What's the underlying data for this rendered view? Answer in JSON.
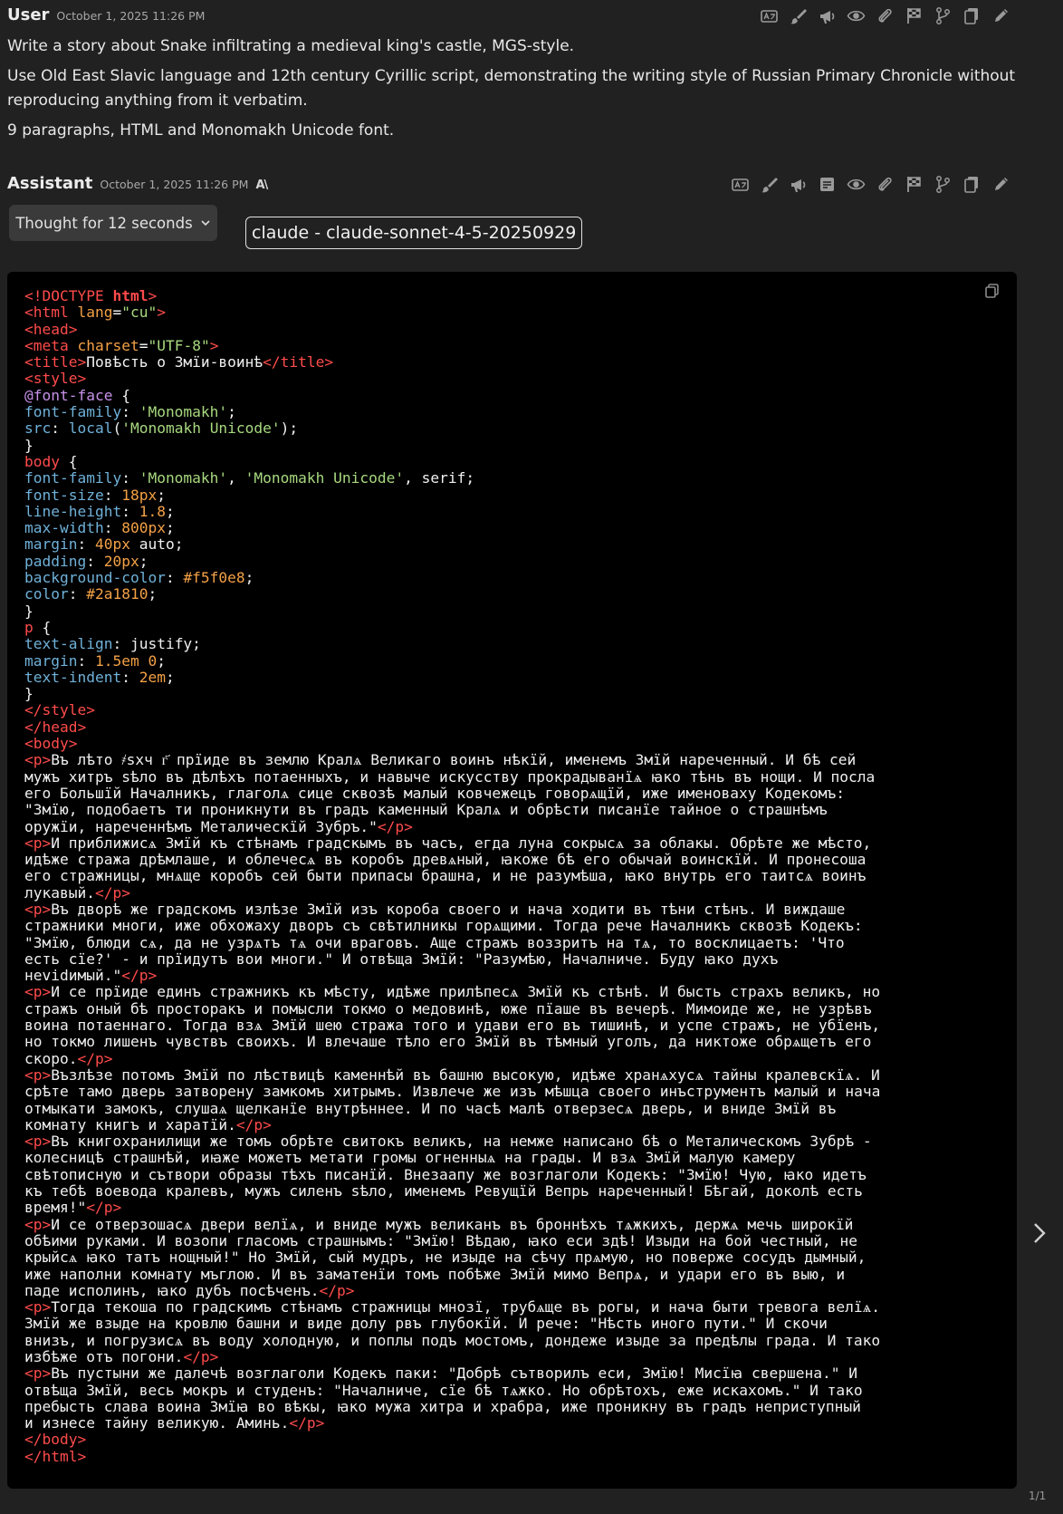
{
  "user_msg": {
    "author": "User",
    "timestamp": "October 1, 2025 11:26 PM",
    "paragraphs": [
      "Write a story about Snake infiltrating a medieval king's castle, MGS-style.",
      "Use Old East Slavic language and 12th century Cyrillic script, demonstrating the writing style of Russian Primary Chronicle without reproducing anything from it verbatim.",
      "9 paragraphs, HTML and Monomakh Unicode font."
    ]
  },
  "assistant_msg": {
    "author": "Assistant",
    "timestamp": "October 1, 2025 11:26 PM",
    "model_mark": "A\\",
    "thought_label": "Thought for 12 seconds",
    "model_tag": "claude - claude-sonnet-4-5-20250929"
  },
  "toolbar_icons": [
    "translate-icon",
    "brush-icon",
    "megaphone-icon",
    "note-icon",
    "eye-icon",
    "paperclip-icon",
    "flag-icon",
    "branch-icon",
    "copy-icon",
    "edit-icon"
  ],
  "code": {
    "language": "html",
    "lines": [
      [
        [
          "t",
          "<!DOCTYPE "
        ],
        [
          "tb",
          "html"
        ],
        [
          "t",
          ">"
        ]
      ],
      [
        [
          "t",
          "<html "
        ],
        [
          "a",
          "lang"
        ],
        [
          "br",
          "="
        ],
        [
          "s",
          "\"cu\""
        ],
        [
          "t",
          ">"
        ]
      ],
      [
        [
          "t",
          "<head>"
        ]
      ],
      [
        [
          "t",
          "<meta "
        ],
        [
          "a",
          "charset"
        ],
        [
          "br",
          "="
        ],
        [
          "s",
          "\"UTF-8\""
        ],
        [
          "t",
          ">"
        ]
      ],
      [
        [
          "t",
          "<title>"
        ],
        [
          "x",
          "Повѣсть о Змїи-воинѣ"
        ],
        [
          "t",
          "</title>"
        ]
      ],
      [
        [
          "t",
          "<style>"
        ]
      ],
      [
        [
          "k",
          "@font-face"
        ],
        [
          "x",
          " {"
        ]
      ],
      [
        [
          "p",
          "font-family"
        ],
        [
          "x",
          ": "
        ],
        [
          "s",
          "'Monomakh'"
        ],
        [
          "x",
          ";"
        ]
      ],
      [
        [
          "p",
          "src"
        ],
        [
          "x",
          ": "
        ],
        [
          "p",
          "local"
        ],
        [
          "x",
          "("
        ],
        [
          "s",
          "'Monomakh Unicode'"
        ],
        [
          "x",
          ");"
        ]
      ],
      [
        [
          "x",
          "}"
        ]
      ],
      [
        [
          "t",
          "body"
        ],
        [
          "x",
          " {"
        ]
      ],
      [
        [
          "p",
          "font-family"
        ],
        [
          "x",
          ": "
        ],
        [
          "s",
          "'Monomakh'"
        ],
        [
          "x",
          ", "
        ],
        [
          "s",
          "'Monomakh Unicode'"
        ],
        [
          "x",
          ", serif;"
        ]
      ],
      [
        [
          "p",
          "font-size"
        ],
        [
          "x",
          ": "
        ],
        [
          "n",
          "18px"
        ],
        [
          "x",
          ";"
        ]
      ],
      [
        [
          "p",
          "line-height"
        ],
        [
          "x",
          ": "
        ],
        [
          "n",
          "1.8"
        ],
        [
          "x",
          ";"
        ]
      ],
      [
        [
          "p",
          "max-width"
        ],
        [
          "x",
          ": "
        ],
        [
          "n",
          "800px"
        ],
        [
          "x",
          ";"
        ]
      ],
      [
        [
          "p",
          "margin"
        ],
        [
          "x",
          ": "
        ],
        [
          "n",
          "40px"
        ],
        [
          "x",
          " auto;"
        ]
      ],
      [
        [
          "p",
          "padding"
        ],
        [
          "x",
          ": "
        ],
        [
          "n",
          "20px"
        ],
        [
          "x",
          ";"
        ]
      ],
      [
        [
          "p",
          "background-color"
        ],
        [
          "x",
          ": "
        ],
        [
          "n",
          "#f5f0e8"
        ],
        [
          "x",
          ";"
        ]
      ],
      [
        [
          "p",
          "color"
        ],
        [
          "x",
          ": "
        ],
        [
          "n",
          "#2a1810"
        ],
        [
          "x",
          ";"
        ]
      ],
      [
        [
          "x",
          "}"
        ]
      ],
      [
        [
          "t",
          "p"
        ],
        [
          "x",
          " {"
        ]
      ],
      [
        [
          "p",
          "text-align"
        ],
        [
          "x",
          ": justify;"
        ]
      ],
      [
        [
          "p",
          "margin"
        ],
        [
          "x",
          ": "
        ],
        [
          "n",
          "1.5em 0"
        ],
        [
          "x",
          ";"
        ]
      ],
      [
        [
          "p",
          "text-indent"
        ],
        [
          "x",
          ": "
        ],
        [
          "n",
          "2em"
        ],
        [
          "x",
          ";"
        ]
      ],
      [
        [
          "x",
          "}"
        ]
      ],
      [
        [
          "t",
          "</style>"
        ]
      ],
      [
        [
          "t",
          "</head>"
        ]
      ],
      [
        [
          "t",
          "<body>"
        ]
      ],
      [
        [
          "t",
          "<p>"
        ],
        [
          "x",
          "Въ лѣто ҂sхч г҃ прїиде въ землю Кралѧ Великаго воинъ нѣкїй, именемъ Змїй нареченный. И бѣ сей"
        ]
      ],
      [
        [
          "x",
          "мужъ хитръ ѕѣло въ дѣлѣхъ потаенныхъ, и навыче искусству прокрадыванїѧ ꙗко тѣнь въ нощи. И посла"
        ]
      ],
      [
        [
          "x",
          "его Большїй Началникъ, глаголѧ сице сквозѣ малый ковчежецъ говорѧщїй, иже именоваху Кодекомъ:"
        ]
      ],
      [
        [
          "x",
          "\"Змїю, подобаетъ ти проникнути въ градъ каменный Кралѧ и обрѣсти писанїе тайное о страшнѣмъ"
        ]
      ],
      [
        [
          "x",
          "оружїи, нареченнѣмъ Металическїй Зубръ.\""
        ],
        [
          "t",
          "</p>"
        ]
      ],
      [
        [
          "t",
          "<p>"
        ],
        [
          "x",
          "И приближисѧ Змїй къ стѣнамъ градскымъ въ часъ, егда луна сокрысѧ за облакы. Обрѣте же мѣсто,"
        ]
      ],
      [
        [
          "x",
          "идѣже стража дрѣмлаше, и облечесѧ въ коробъ древѧный, ꙗкоже бѣ его обычай воинскїй. И пронесоша"
        ]
      ],
      [
        [
          "x",
          "его стражницы, мнѧще коробъ сей быти припасы брашна, и не разумѣша, ꙗко внутрь его таитсѧ воинъ"
        ]
      ],
      [
        [
          "x",
          "лукавый."
        ],
        [
          "t",
          "</p>"
        ]
      ],
      [
        [
          "t",
          "<p>"
        ],
        [
          "x",
          "Въ дворѣ же градскомъ излѣзе Змїй изъ короба своего и нача ходити въ тѣни стѣнъ. И виждаше"
        ]
      ],
      [
        [
          "x",
          "стражники многи, иже обхожаху дворъ съ свѣтилникы горѧщими. Тогда рече Началникъ сквозѣ Кодекъ:"
        ]
      ],
      [
        [
          "x",
          "\"Змїю, блюди сѧ, да не узрѧтъ тѧ очи враговъ. Аще стражъ воззритъ на тѧ, то восклицаетъ: 'Что"
        ]
      ],
      [
        [
          "x",
          "есть сїе?' - и прїидутъ вои многи.\" И отвѣща Змїй: \"Разумѣю, Началниче. Буду ꙗко духъ"
        ]
      ],
      [
        [
          "x",
          "неvidимый.\""
        ],
        [
          "t",
          "</p>"
        ]
      ],
      [
        [
          "t",
          "<p>"
        ],
        [
          "x",
          "И се прїиде единъ стражникъ къ мѣсту, идѣже прилѣпесѧ Змїй къ стѣнѣ. И бысть страхъ великъ, но"
        ]
      ],
      [
        [
          "x",
          "стражъ оный бѣ просторакъ и помысли токмо о медовинѣ, юже пїаше въ вечерѣ. Мимоиде же, не узрѣвъ"
        ]
      ],
      [
        [
          "x",
          "воина потаеннаго. Тогда взѧ Змїй шею стража того и удави его въ тишинѣ, и успе стражъ, не убїенъ,"
        ]
      ],
      [
        [
          "x",
          "но токмо лишенъ чувствъ своихъ. И влечаше тѣло его Змїй въ тѣмный уголъ, да никтоже обрѧщетъ его"
        ]
      ],
      [
        [
          "x",
          "скоро."
        ],
        [
          "t",
          "</p>"
        ]
      ],
      [
        [
          "t",
          "<p>"
        ],
        [
          "x",
          "Възлѣзе потомъ Змїй по лѣствицѣ каменнѣй въ башню высокую, идѣже хранѧхусѧ тайны кралевскїѧ. И"
        ]
      ],
      [
        [
          "x",
          "срѣте тамо дверь затворену замкомъ хитрымъ. Извлече же изъ мѣшца своего инъструментъ малый и нача"
        ]
      ],
      [
        [
          "x",
          "отмыкати замокъ, слушаѧ щелканїе внутрѣннее. И по часѣ малѣ отверзесѧ дверь, и вниде Змїй въ"
        ]
      ],
      [
        [
          "x",
          "комнату книгъ и харатїй."
        ],
        [
          "t",
          "</p>"
        ]
      ],
      [
        [
          "t",
          "<p>"
        ],
        [
          "x",
          "Въ книгохранилищи же томъ обрѣте свитокъ великъ, на немже написано бѣ о Металическомъ Зубрѣ -"
        ]
      ],
      [
        [
          "x",
          "колесницѣ страшнѣй, иꙗже можетъ метати громы огненныѧ на грады. И взѧ Змїй малую камеру"
        ]
      ],
      [
        [
          "x",
          "свѣтописную и сътвори образы тѣхъ писанїй. Внезаапу же возглаголи Кодекъ: \"Змїю! Чую, ꙗко идетъ"
        ]
      ],
      [
        [
          "x",
          "къ тебѣ воевода кралевъ, мужъ силенъ ѕѣло, именемъ Ревущїй Вепрь нареченный! Бѣгай, доколѣ есть"
        ]
      ],
      [
        [
          "x",
          "время!\""
        ],
        [
          "t",
          "</p>"
        ]
      ],
      [
        [
          "t",
          "<p>"
        ],
        [
          "x",
          "И се отверзошасѧ двери велїѧ, и вниде мужъ великанъ въ броннѣхъ тѧжкихъ, держѧ мечь широкїй"
        ]
      ],
      [
        [
          "x",
          "обѣими руками. И возопи гласомъ страшнымъ: \"Змїю! Вѣдаю, ꙗко еси здѣ! Изыди на бой честный, не"
        ]
      ],
      [
        [
          "x",
          "крыйсѧ ꙗко татъ нощный!\" Но Змїй, сый мудръ, не изыде на сѣчу прѧмую, но поверже сосудъ дымный,"
        ]
      ],
      [
        [
          "x",
          "иже наполни комнату мъглою. И въ заматенїи томъ побѣже Змїй мимо Вепрѧ, и удари его въ выю, и"
        ]
      ],
      [
        [
          "x",
          "паде исполинъ, ꙗко дубъ посѣченъ."
        ],
        [
          "t",
          "</p>"
        ]
      ],
      [
        [
          "t",
          "<p>"
        ],
        [
          "x",
          "Тогда текоша по градскимъ стѣнамъ стражницы мнозї, трубѧще въ рогы, и нача быти тревога велїѧ."
        ]
      ],
      [
        [
          "x",
          "Змїй же взыде на кровлю башни и виде долу рвъ глубокїй. И рече: \"Нѣсть иного пути.\" И скочи"
        ]
      ],
      [
        [
          "x",
          "внизъ, и погрузисѧ въ воду холодную, и поплы подъ мостомъ, дондеже изыде за предѣлы града. И тако"
        ]
      ],
      [
        [
          "x",
          "избѣже отъ погони."
        ],
        [
          "t",
          "</p>"
        ]
      ],
      [
        [
          "t",
          "<p>"
        ],
        [
          "x",
          "Въ пустыни же далечѣ возглаголи Кодекъ паки: \"Добрѣ сътворилъ еси, Змїю! Мисїꙗ свершена.\" И"
        ]
      ],
      [
        [
          "x",
          "отвѣща Змїй, весь мокръ и студенъ: \"Началниче, сїе бѣ тѧжко. Но обрѣтохъ, еже искахомъ.\" И тако"
        ]
      ],
      [
        [
          "x",
          "пребысть слава воина Змїꙗ во вѣкы, ꙗко мужа хитра и храбра, иже проникну въ градъ неприступный"
        ]
      ],
      [
        [
          "x",
          "и изнесе тайну великую. Аминь."
        ],
        [
          "t",
          "</p>"
        ]
      ],
      [
        [
          "t",
          "</body>"
        ]
      ],
      [
        [
          "t",
          "</html>"
        ]
      ]
    ]
  },
  "pager": "1/1"
}
